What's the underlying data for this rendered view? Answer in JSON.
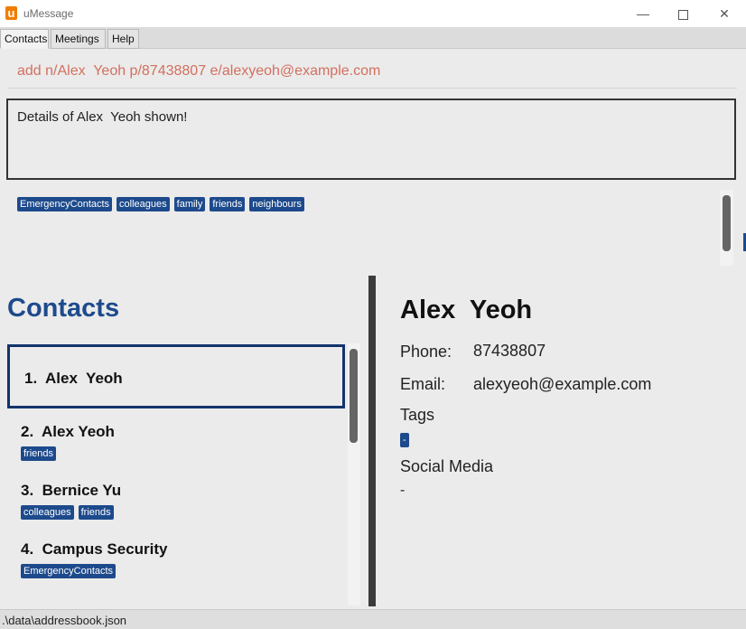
{
  "window": {
    "title": "uMessage",
    "logo_letter": "u",
    "minimize": "—",
    "close": "✕"
  },
  "menu": {
    "tabs": [
      "Contacts",
      "Meetings",
      "Help"
    ]
  },
  "command": {
    "text": "add n/Alex  Yeoh p/87438807 e/alexyeoh@example.com"
  },
  "result": {
    "text": "Details of Alex  Yeoh shown!"
  },
  "tag_bar": {
    "tags": [
      "EmergencyContacts",
      "colleagues",
      "family",
      "friends",
      "neighbours"
    ]
  },
  "contacts": {
    "heading": "Contacts",
    "items": [
      {
        "name": "1.  Alex  Yeoh",
        "tags": []
      },
      {
        "name": "2.  Alex Yeoh",
        "tags": [
          "friends"
        ]
      },
      {
        "name": "3.  Bernice Yu",
        "tags": [
          "colleagues",
          "friends"
        ]
      },
      {
        "name": "4.  Campus Security",
        "tags": [
          "EmergencyContacts"
        ]
      }
    ]
  },
  "details": {
    "name": "Alex  Yeoh",
    "phone_label": "Phone:",
    "phone": "87438807",
    "email_label": "Email:",
    "email": "alexyeoh@example.com",
    "tags_label": "Tags",
    "tag_value": "-",
    "social_label": "Social Media",
    "social_value": "-"
  },
  "status": {
    "path": ".\\data\\addressbook.json"
  },
  "colors": {
    "accent": "#1d4a8c",
    "command": "#d2705f",
    "logo": "#f07d00"
  }
}
